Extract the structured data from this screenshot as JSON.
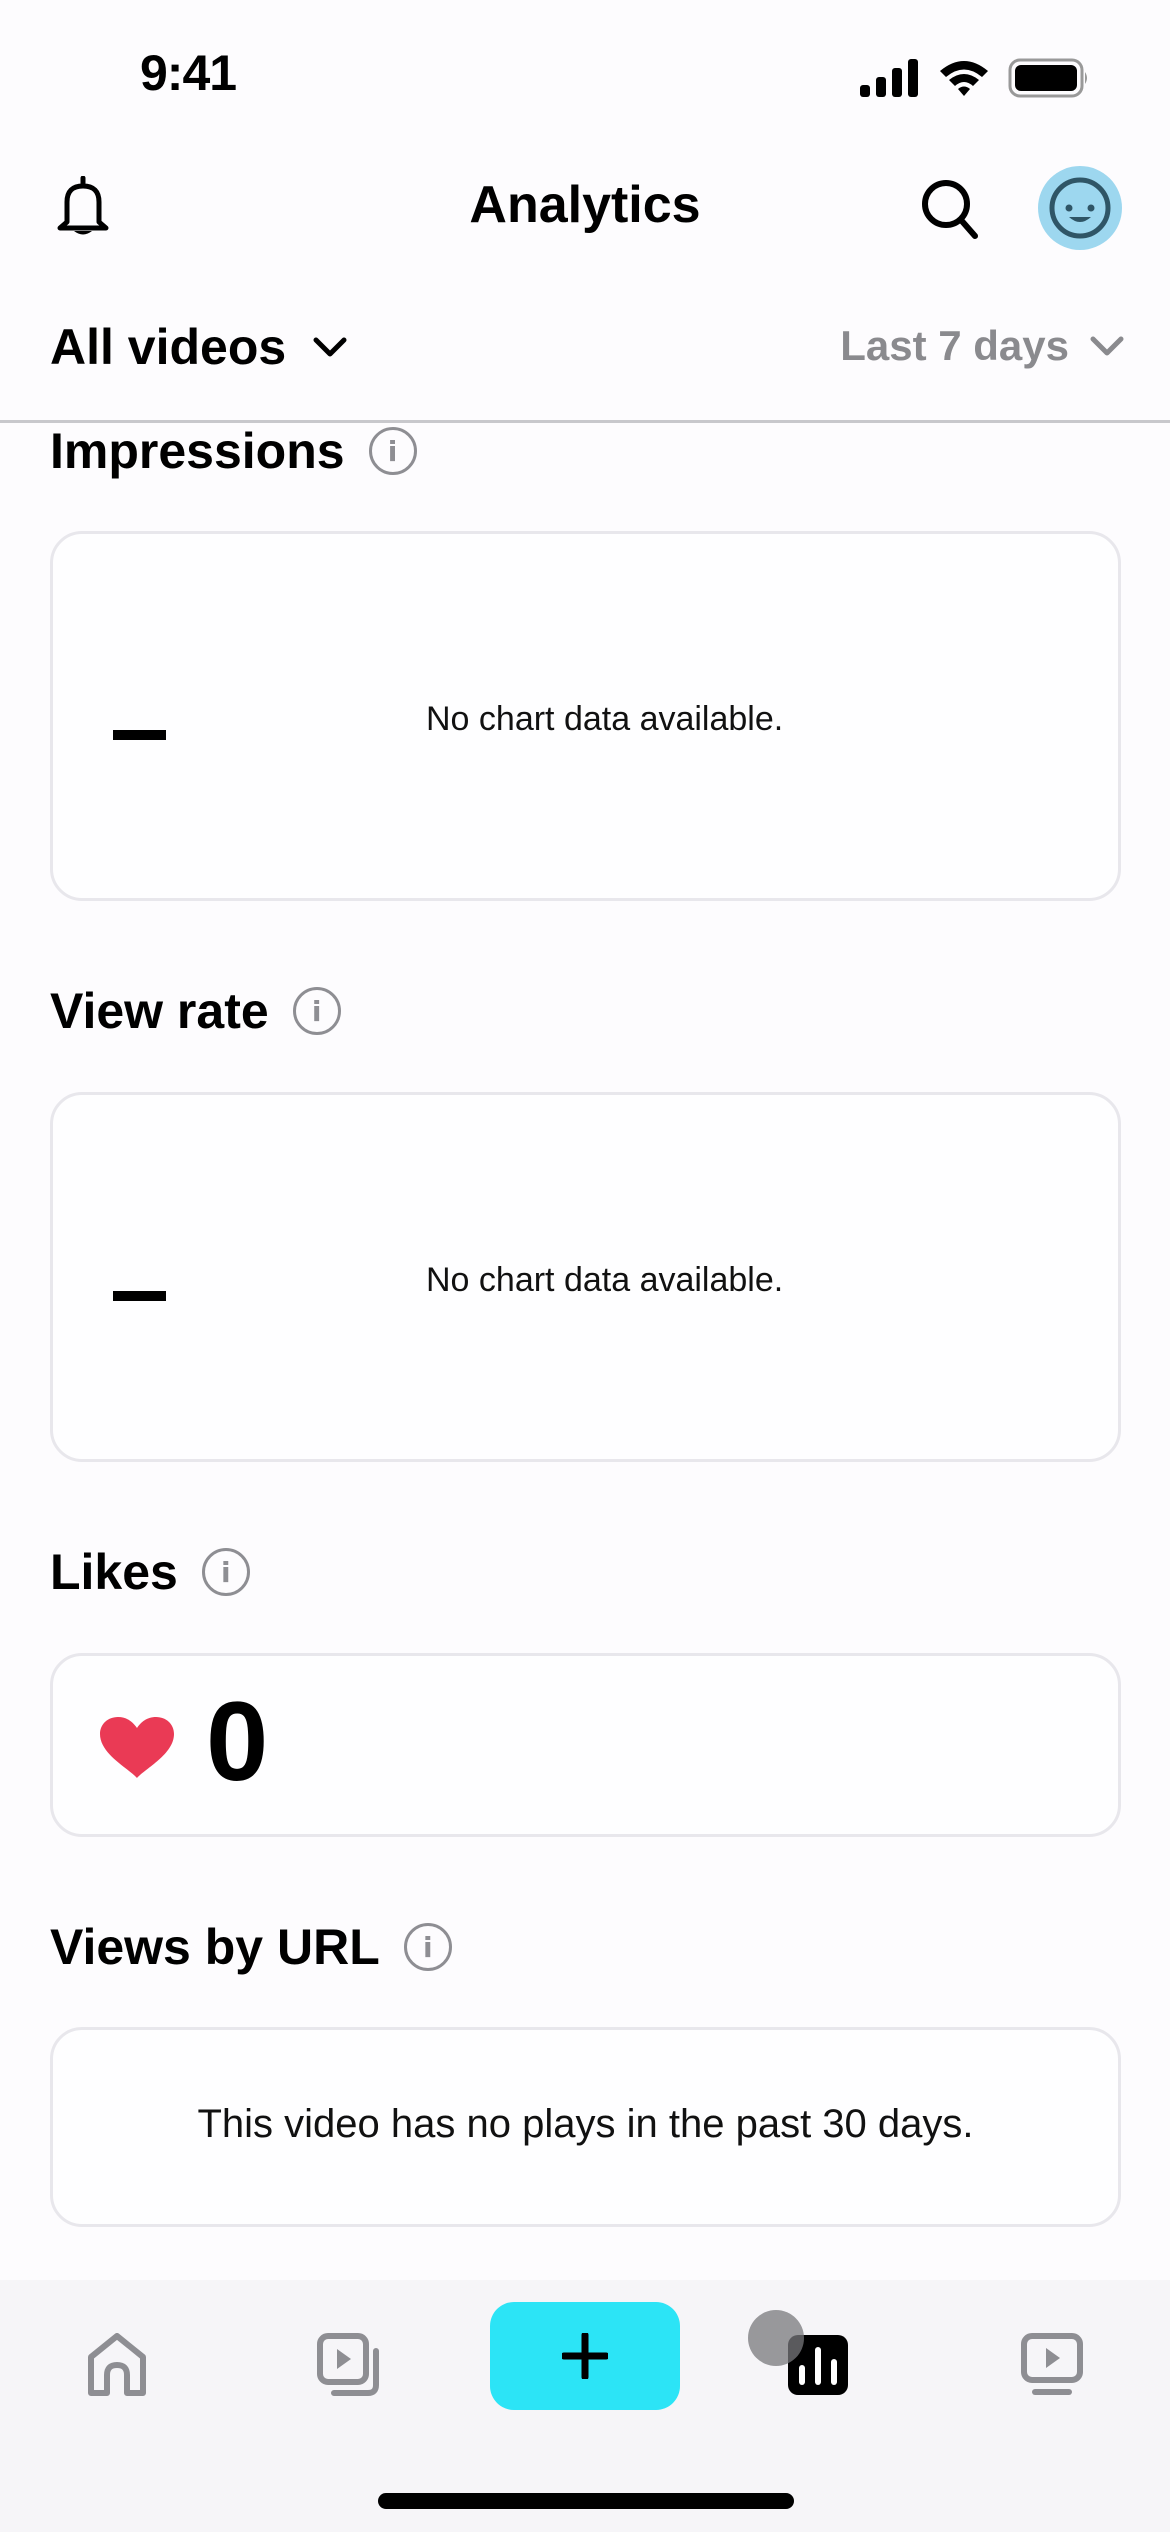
{
  "status_bar": {
    "time": "9:41"
  },
  "header": {
    "title": "Analytics",
    "left_icon": "bell-icon",
    "right_icons": [
      "search-icon",
      "avatar"
    ]
  },
  "filters": {
    "video_scope": "All videos",
    "date_range": "Last 7 days"
  },
  "sections": {
    "impressions": {
      "title": "Impressions",
      "value": "–",
      "empty_message": "No chart data available."
    },
    "view_rate": {
      "title": "View rate",
      "value": "–",
      "empty_message": "No chart data available."
    },
    "likes": {
      "title": "Likes",
      "value": "0"
    },
    "views_by_url": {
      "title": "Views by URL",
      "empty_message": "This video has no plays in the past 30 days."
    }
  },
  "info_icon_glyph": "i",
  "tabbar": {
    "items": [
      {
        "name": "home",
        "icon": "home-icon",
        "active": false
      },
      {
        "name": "videos",
        "icon": "video-library-icon",
        "active": false
      },
      {
        "name": "create",
        "icon": "plus-icon",
        "active": false
      },
      {
        "name": "analytics",
        "icon": "analytics-icon",
        "active": true
      },
      {
        "name": "channel",
        "icon": "tv-play-icon",
        "active": false
      }
    ],
    "add_label": "+"
  },
  "colors": {
    "accent": "#2ce4f6",
    "heart": "#ea3a55",
    "avatar_bg": "#9dd7ef",
    "muted": "#8a8a8e"
  }
}
